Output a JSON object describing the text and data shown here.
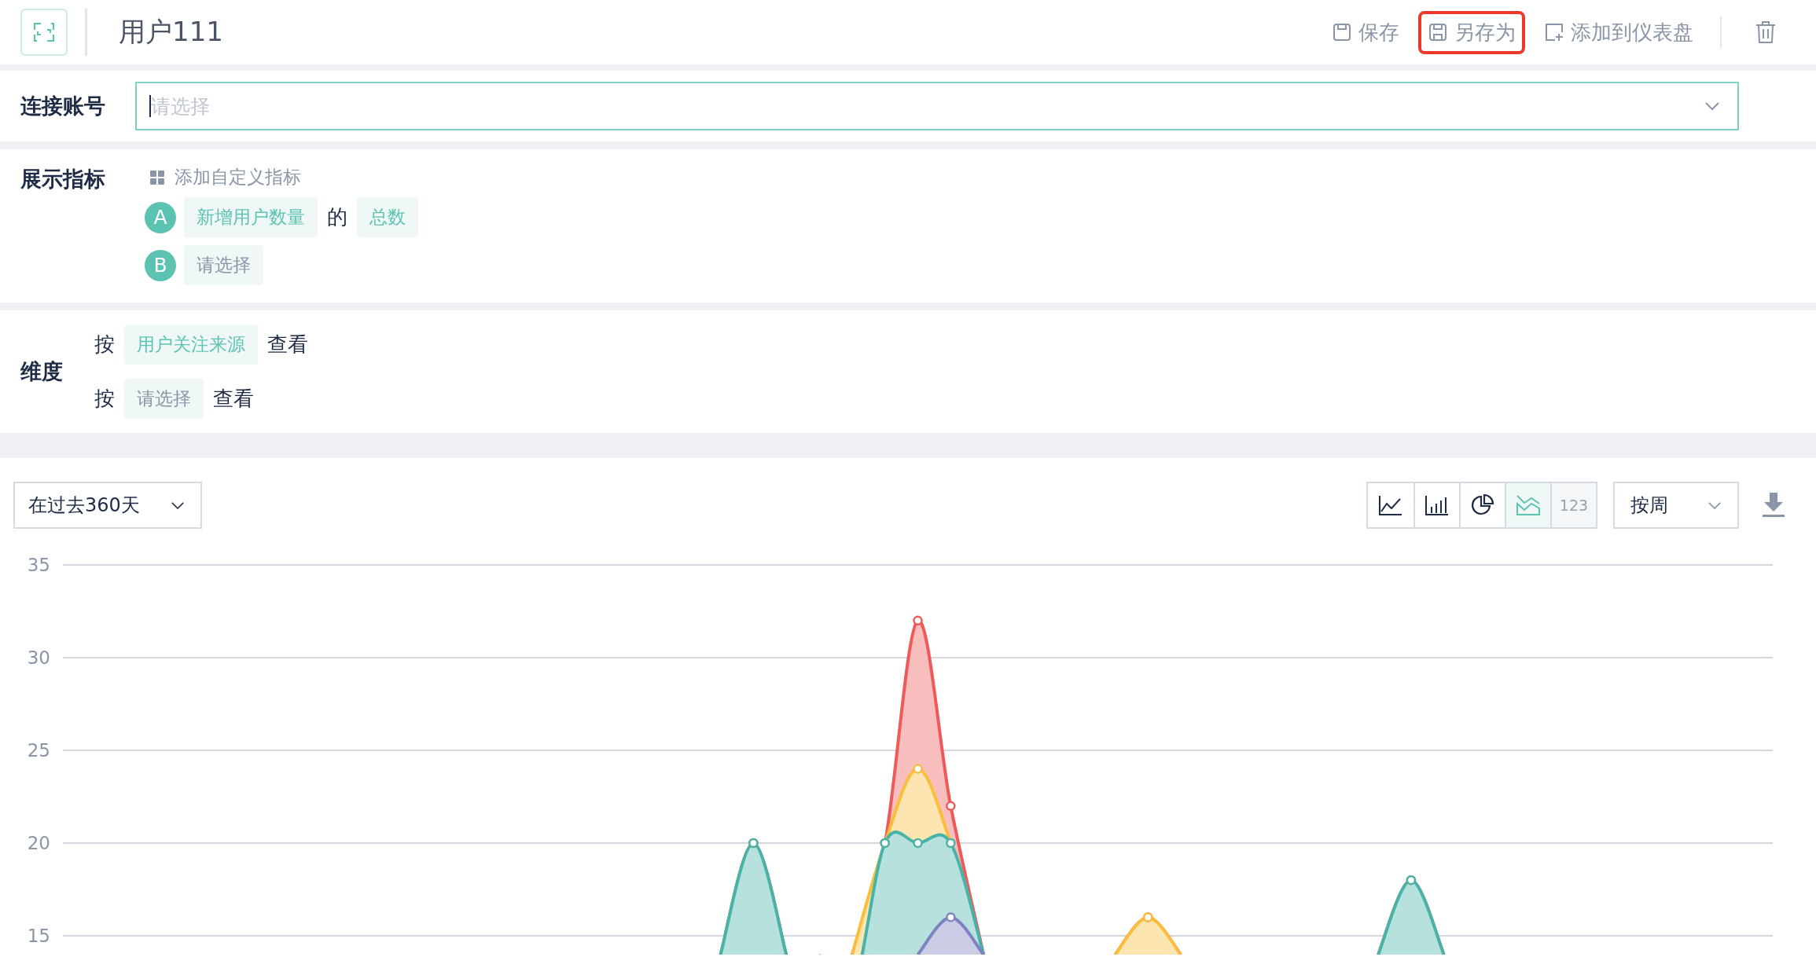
{
  "header": {
    "title": "用户111",
    "actions": [
      {
        "kind": "save",
        "label": "保存",
        "highlighted": false
      },
      {
        "kind": "save-as",
        "label": "另存为",
        "highlighted": true
      },
      {
        "kind": "add",
        "label": "添加到仪表盘",
        "highlighted": false
      }
    ]
  },
  "connect": {
    "label": "连接账号",
    "placeholder": "请选择"
  },
  "metrics": {
    "label": "展示指标",
    "add_link": "添加自定义指标",
    "items": [
      {
        "badge": "A",
        "metric": "新增用户数量",
        "filled": true,
        "joiner": "的",
        "aggregate": "总数"
      },
      {
        "badge": "B",
        "metric": "请选择",
        "filled": false
      }
    ]
  },
  "dimensions": {
    "label": "维度",
    "rows": [
      {
        "prefix": "按",
        "value": "用户关注来源",
        "filled": true,
        "suffix": "查看"
      },
      {
        "prefix": "按",
        "value": "请选择",
        "filled": false,
        "suffix": "查看"
      }
    ]
  },
  "toolbar": {
    "range": "在过去360天",
    "chart_types": [
      {
        "kind": "line",
        "selected": false,
        "disabled": false
      },
      {
        "kind": "bar",
        "selected": false,
        "disabled": false
      },
      {
        "kind": "pie",
        "selected": false,
        "disabled": false
      },
      {
        "kind": "area",
        "selected": true,
        "disabled": false
      },
      {
        "kind": "number",
        "label": "123",
        "selected": false,
        "disabled": true
      }
    ],
    "granularity": "按周"
  },
  "chart": {
    "y_labels": [
      "35",
      "30",
      "25",
      "20",
      "15"
    ]
  }
}
